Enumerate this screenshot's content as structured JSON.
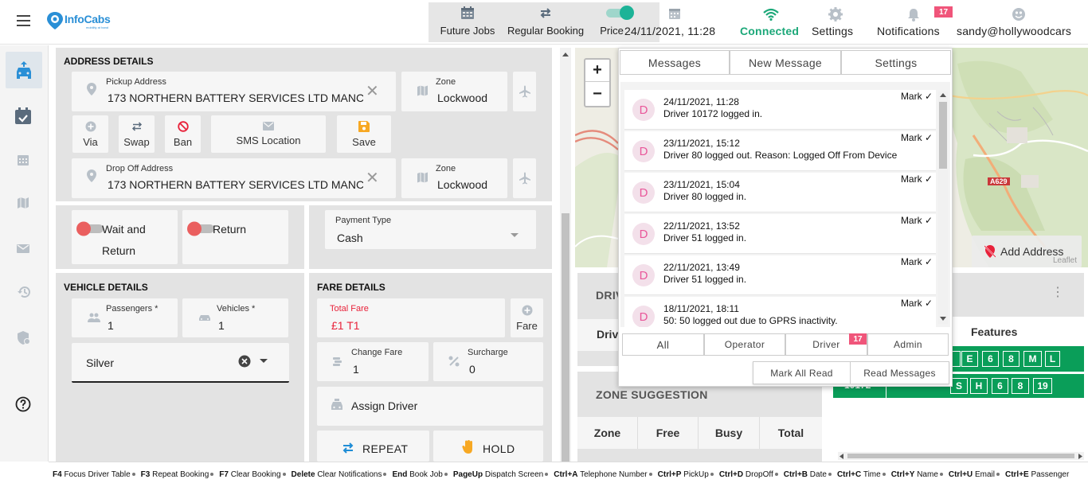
{
  "header": {
    "logo_text": "InfoCabs",
    "logo_subtext": "mobility at hand",
    "nav": [
      {
        "label": "Future Jobs",
        "icon": "calendar-grid-icon"
      },
      {
        "label": "Regular Booking",
        "icon": "repeat-icon"
      },
      {
        "label": "Price",
        "icon": "toggle-icon"
      }
    ],
    "datetime": "24/11/2021, 11:28",
    "connection": "Connected",
    "settings": "Settings",
    "notifications": "Notifications",
    "notifications_badge": "17",
    "user": "sandy@hollywoodcars",
    "colors": {
      "connected": "#1ca879",
      "teal": "#26b5a0",
      "badge": "#f0557a"
    }
  },
  "sidebar": {
    "items": [
      {
        "icon": "car-dispatch-icon",
        "active": true
      },
      {
        "icon": "calendar-check-icon"
      },
      {
        "icon": "calendar-icon"
      },
      {
        "icon": "map-icon"
      },
      {
        "icon": "mail-icon"
      },
      {
        "icon": "history-icon"
      },
      {
        "icon": "shield-icon"
      },
      {
        "icon": "help-icon"
      }
    ]
  },
  "address": {
    "title": "ADDRESS DETAILS",
    "pickup_label": "Pickup Address",
    "pickup_value": "173 NORTHERN BATTERY SERVICES LTD MANCHESTER",
    "zone_label": "Zone",
    "pickup_zone": "Lockwood",
    "buttons": [
      "Via",
      "Swap",
      "Ban",
      "SMS Location",
      "Save"
    ],
    "dropoff_label": "Drop Off Address",
    "dropoff_value": "173 NORTHERN BATTERY SERVICES LTD MANCHESTER",
    "dropoff_zone": "Lockwood"
  },
  "options": {
    "wait_return_line1": "Wait and",
    "wait_return_line2": "Return",
    "return_label": "Return",
    "payment_label": "Payment Type",
    "payment_value": "Cash"
  },
  "vehicle": {
    "title": "VEHICLE DETAILS",
    "passengers_label": "Passengers *",
    "passengers_value": "1",
    "vehicles_label": "Vehicles *",
    "vehicles_value": "1",
    "vehicle_type": "Silver"
  },
  "fare": {
    "title": "FARE DETAILS",
    "total_label": "Total Fare",
    "total_value": "£1 T1",
    "fare_button": "Fare",
    "change_label": "Change Fare",
    "change_value": "1",
    "surcharge_label": "Surcharge",
    "surcharge_value": "0",
    "assign_driver": "Assign Driver",
    "repeat": "REPEAT",
    "hold": "HOLD"
  },
  "map": {
    "zoom_in": "+",
    "zoom_out": "−",
    "road_label": "A629",
    "add_address": "Add Address",
    "attribution": "Leaflet"
  },
  "messages": {
    "tabs": [
      "Messages",
      "New Message",
      "Settings"
    ],
    "items": [
      {
        "avatar": "D",
        "time": "24/11/2021, 11:28",
        "text": "Driver 10172 logged in.",
        "mark": "Mark ✓"
      },
      {
        "avatar": "D",
        "time": "23/11/2021, 15:12",
        "text": "Driver 80 logged out. Reason: Logged Off From Device",
        "mark": "Mark ✓"
      },
      {
        "avatar": "D",
        "time": "23/11/2021, 15:04",
        "text": "Driver 80 logged in.",
        "mark": "Mark ✓"
      },
      {
        "avatar": "D",
        "time": "22/11/2021, 13:52",
        "text": "Driver 51 logged in.",
        "mark": "Mark ✓"
      },
      {
        "avatar": "D",
        "time": "22/11/2021, 13:49",
        "text": "Driver 51 logged in.",
        "mark": "Mark ✓"
      },
      {
        "avatar": "D",
        "time": "18/11/2021, 18:11",
        "text": "50: 50 logged out due to GPRS inactivity.",
        "mark": "Mark ✓"
      }
    ],
    "filters": [
      "All",
      "Operator",
      "Driver",
      "Admin"
    ],
    "driver_badge": "17",
    "mark_all_read": "Mark All Read",
    "read_messages": "Read Messages"
  },
  "drivers": {
    "title_partial": "DRIV",
    "col_partial": "Drive",
    "features_header": "Features",
    "row1_features": [
      "E",
      "6",
      "8",
      "M",
      "L"
    ],
    "row2_id": "10172",
    "row2_features": [
      "S",
      "H",
      "6",
      "8",
      "19"
    ],
    "green": "#0a9e59"
  },
  "zone_suggestion": {
    "title": "ZONE SUGGESTION",
    "columns": [
      "Zone",
      "Free",
      "Busy",
      "Total"
    ]
  },
  "shortcuts": [
    {
      "key": "F4",
      "text": "Focus Driver Table"
    },
    {
      "key": "F3",
      "text": "Repeat Booking"
    },
    {
      "key": "F7",
      "text": "Clear Booking"
    },
    {
      "key": "Delete",
      "text": "Clear Notifications"
    },
    {
      "key": "End",
      "text": "Book Job"
    },
    {
      "key": "PageUp",
      "text": "Dispatch Screen"
    },
    {
      "key": "Ctrl+A",
      "text": "Telephone Number"
    },
    {
      "key": "Ctrl+P",
      "text": "PickUp"
    },
    {
      "key": "Ctrl+D",
      "text": "DropOff"
    },
    {
      "key": "Ctrl+B",
      "text": "Date"
    },
    {
      "key": "Ctrl+C",
      "text": "Time"
    },
    {
      "key": "Ctrl+Y",
      "text": "Name"
    },
    {
      "key": "Ctrl+U",
      "text": "Email"
    },
    {
      "key": "Ctrl+E",
      "text": "Passenger"
    }
  ]
}
